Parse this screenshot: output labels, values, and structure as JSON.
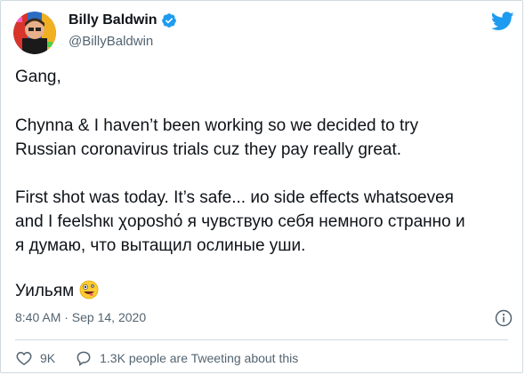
{
  "tweet": {
    "author_name": "Billy Baldwin",
    "author_handle": "@BillyBaldwin",
    "lines": [
      "Gang,",
      "Chynna & I haven’t been working so we decided to try",
      "Russian coronavirus trials cuz they pay really great.",
      "First shot was today. It’s safe... ио side effects whatsoeveя",
      "and I feelshкι χороshό я чувствую себя немного странно и",
      "я думаю, что вытащил ослиные уши.",
      "Уильям"
    ],
    "timestamp": "8:40 AM · Sep 14, 2020",
    "like_count": "9K",
    "reply_text": "1.3K people are Tweeting about this"
  },
  "icons": {
    "verified": "verified-badge-icon",
    "logo": "twitter-bird-icon",
    "emoji": "zany-face-emoji",
    "info": "info-icon",
    "like": "heart-icon",
    "reply": "speech-bubble-icon"
  },
  "colors": {
    "twitter_blue": "#1d9bf0",
    "text_primary": "#0f1419",
    "text_secondary": "#536471",
    "border": "#cfd9de"
  }
}
